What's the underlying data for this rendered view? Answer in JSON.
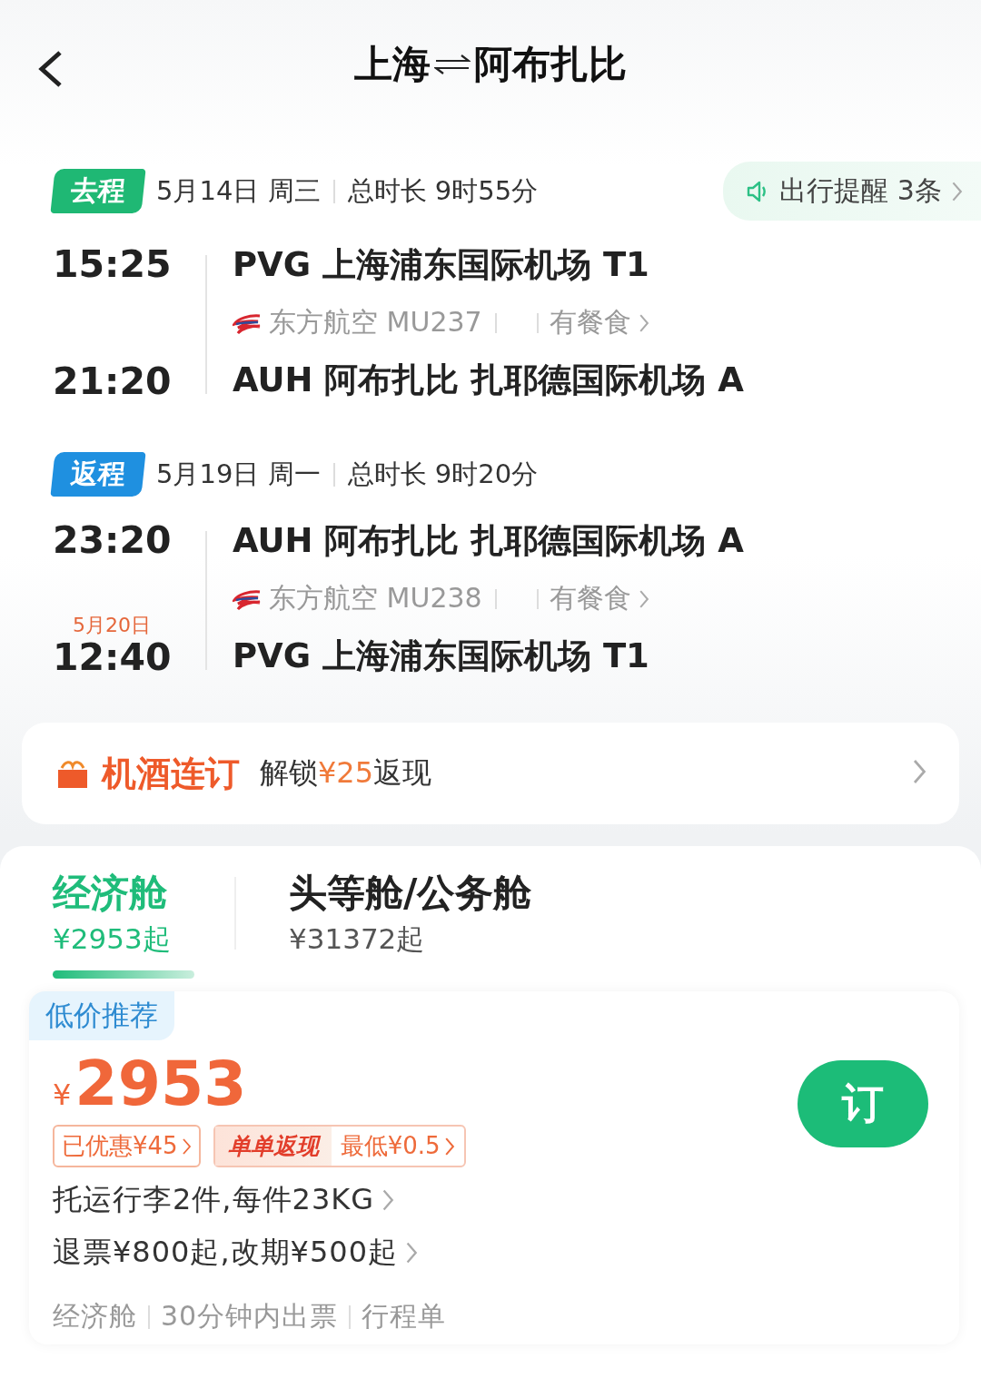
{
  "header": {
    "from": "上海",
    "to": "阿布扎比"
  },
  "legs": [
    {
      "kind": "outbound",
      "badge": "去程",
      "date": "5月14日 周三",
      "duration": "总时长 9时55分",
      "reminder": "出行提醒 3条",
      "dep_time": "15:25",
      "dep_airport": "PVG 上海浦东国际机场 T1",
      "airline": "东方航空 MU237",
      "meal": "有餐食",
      "arr_time": "21:20",
      "arr_airport": "AUH 阿布扎比 扎耶德国际机场 A"
    },
    {
      "kind": "return",
      "badge": "返程",
      "date": "5月19日 周一",
      "duration": "总时长 9时20分",
      "dep_time": "23:20",
      "dep_airport": "AUH 阿布扎比 扎耶德国际机场 A",
      "airline": "东方航空 MU238",
      "meal": "有餐食",
      "arr_date": "5月20日",
      "arr_time": "12:40",
      "arr_airport": "PVG 上海浦东国际机场 T1"
    }
  ],
  "promo": {
    "brand": "机酒连订",
    "prefix": "解锁",
    "amount": "¥25",
    "suffix": "返现"
  },
  "cabins": [
    {
      "name": "经济舱",
      "price": "¥2953起",
      "selected": true
    },
    {
      "name": "头等舱/公务舱",
      "price": "¥31372起",
      "selected": false
    }
  ],
  "offer": {
    "tag": "低价推荐",
    "currency": "¥",
    "price": "2953",
    "discount": "已优惠¥45",
    "cashback_label": "单单返现",
    "cashback": "最低¥0.5",
    "details": [
      "托运行李2件,每件23KG",
      "退票¥800起,改期¥500起"
    ],
    "features": [
      "经济舱",
      "30分钟内出票",
      "行程单"
    ],
    "book": "订"
  }
}
